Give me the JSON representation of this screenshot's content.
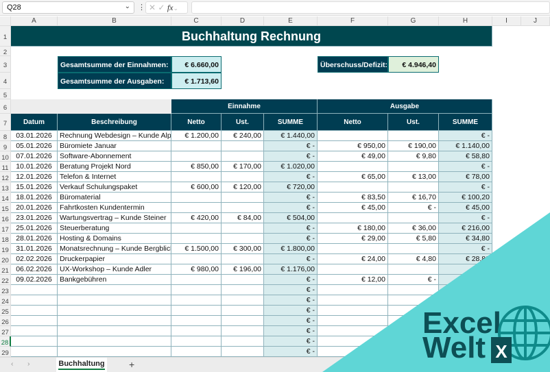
{
  "formula_bar": {
    "name_box": "Q28",
    "fx": "fx",
    "formula": ""
  },
  "columns": [
    "A",
    "B",
    "C",
    "D",
    "E",
    "F",
    "G",
    "H",
    "I",
    "J"
  ],
  "title": "Buchhaltung Rechnung",
  "summary": {
    "income_label": "Gesamtsumme der Einnahmen:",
    "income_value": "€ 6.660,00",
    "expense_label": "Gesamtsumme der Ausgaben:",
    "expense_value": "€ 1.713,60",
    "surplus_label": "Überschuss/Defizit:",
    "surplus_value": "€ 4.946,40"
  },
  "groups": {
    "income": "Einnahme",
    "expense": "Ausgabe"
  },
  "headers": [
    "Datum",
    "Beschreibung",
    "Netto",
    "Ust.",
    "SUMME",
    "Netto",
    "Ust.",
    "SUMME"
  ],
  "rows": [
    [
      "03.01.2026",
      "Rechnung Webdesign – Kunde Alpenblick",
      "€ 1.200,00",
      "€ 240,00",
      "€ 1.440,00",
      "",
      "",
      "€ -"
    ],
    [
      "05.01.2026",
      "Büromiete Januar",
      "",
      "",
      "€ -",
      "€ 950,00",
      "€ 190,00",
      "€ 1.140,00"
    ],
    [
      "07.01.2026",
      "Software-Abonnement",
      "",
      "",
      "€ -",
      "€ 49,00",
      "€ 9,80",
      "€ 58,80"
    ],
    [
      "10.01.2026",
      "Beratung Projekt Nord",
      "€ 850,00",
      "€ 170,00",
      "€ 1.020,00",
      "",
      "",
      "€ -"
    ],
    [
      "12.01.2026",
      "Telefon & Internet",
      "",
      "",
      "€ -",
      "€ 65,00",
      "€ 13,00",
      "€ 78,00"
    ],
    [
      "15.01.2026",
      "Verkauf Schulungspaket",
      "€ 600,00",
      "€ 120,00",
      "€ 720,00",
      "",
      "",
      "€ -"
    ],
    [
      "18.01.2026",
      "Büromaterial",
      "",
      "",
      "€ -",
      "€ 83,50",
      "€ 16,70",
      "€ 100,20"
    ],
    [
      "20.01.2026",
      "Fahrtkosten Kundentermin",
      "",
      "",
      "€ -",
      "€ 45,00",
      "€ -",
      "€ 45,00"
    ],
    [
      "23.01.2026",
      "Wartungsvertrag – Kunde Steiner",
      "€ 420,00",
      "€ 84,00",
      "€ 504,00",
      "",
      "",
      "€ -"
    ],
    [
      "25.01.2026",
      "Steuerberatung",
      "",
      "",
      "€ -",
      "€ 180,00",
      "€ 36,00",
      "€ 216,00"
    ],
    [
      "28.01.2026",
      "Hosting & Domains",
      "",
      "",
      "€ -",
      "€ 29,00",
      "€ 5,80",
      "€ 34,80"
    ],
    [
      "31.01.2026",
      "Monatsrechnung – Kunde Bergblick",
      "€ 1.500,00",
      "€ 300,00",
      "€ 1.800,00",
      "",
      "",
      "€ -"
    ],
    [
      "02.02.2026",
      "Druckerpapier",
      "",
      "",
      "€ -",
      "€ 24,00",
      "€ 4,80",
      "€ 28,80"
    ],
    [
      "06.02.2026",
      "UX-Workshop – Kunde Adler",
      "€ 980,00",
      "€ 196,00",
      "€ 1.176,00",
      "",
      "",
      ""
    ],
    [
      "09.02.2026",
      "Bankgebühren",
      "",
      "",
      "€ -",
      "€ 12,00",
      "€ -",
      ""
    ],
    [
      "",
      "",
      "",
      "",
      "€ -",
      "",
      "",
      ""
    ],
    [
      "",
      "",
      "",
      "",
      "€ -",
      "",
      "",
      ""
    ],
    [
      "",
      "",
      "",
      "",
      "€ -",
      "",
      "",
      ""
    ],
    [
      "",
      "",
      "",
      "",
      "€ -",
      "",
      "",
      ""
    ],
    [
      "",
      "",
      "",
      "",
      "€ -",
      "",
      "",
      ""
    ],
    [
      "",
      "",
      "",
      "",
      "€ -",
      "",
      "",
      ""
    ],
    [
      "",
      "",
      "",
      "",
      "€ -",
      "",
      "",
      ""
    ]
  ],
  "sheet_tabs": [
    "Buchhaltung"
  ],
  "add_sheet": "+",
  "logo": {
    "line1": "Excel",
    "line2": "Welt",
    "badge": "X"
  },
  "colors": {
    "header": "#00474f",
    "summary": "#003d52",
    "sum_col": "#d8ecee",
    "accent": "#5fd6d6"
  }
}
